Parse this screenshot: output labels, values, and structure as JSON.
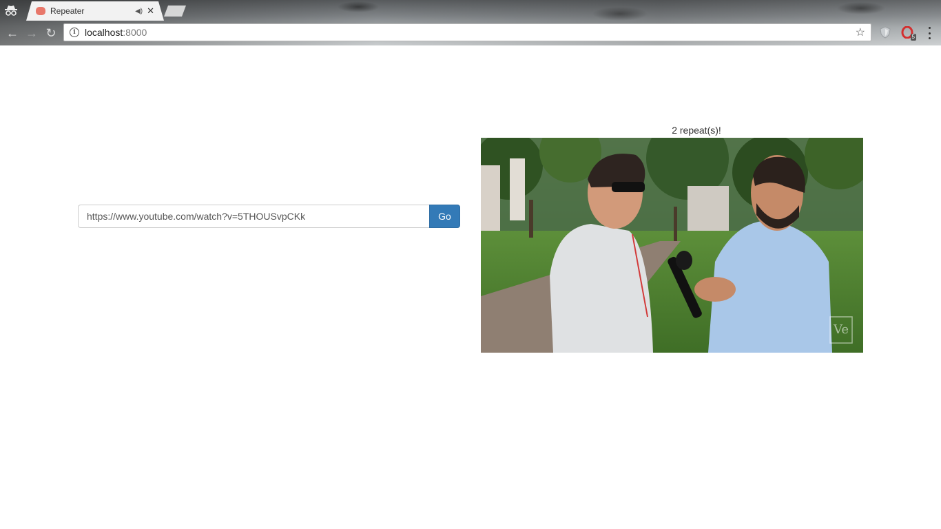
{
  "browser": {
    "tab": {
      "title": "Repeater",
      "favicon_icon": "eraser-icon",
      "audio_icon": "speaker-icon",
      "close_glyph": "✕"
    },
    "address_bar": {
      "host": "localhost",
      "port": ":8000",
      "info_icon": "info-icon",
      "bookmark_icon": "star-icon"
    },
    "nav": {
      "back_glyph": "←",
      "forward_glyph": "→",
      "reload_glyph": "↻"
    },
    "extensions": {
      "opera_badge": "5"
    }
  },
  "page": {
    "url_input_value": "https://www.youtube.com/watch?v=5THOUSvpCKk",
    "go_label": "Go",
    "repeat_status": "2 repeat(s)!",
    "video_watermark": "Ve"
  },
  "colors": {
    "go_button": "#337ab7",
    "page_background": "#ffffff"
  }
}
